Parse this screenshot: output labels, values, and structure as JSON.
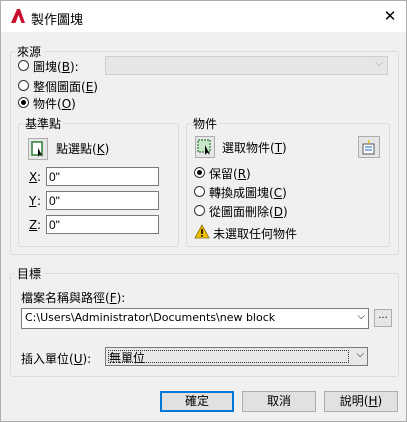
{
  "window": {
    "title": "製作圖塊",
    "app_icon": "autocad-a-icon",
    "close_glyph": "✕"
  },
  "source": {
    "legend": "來源",
    "options": [
      {
        "label": "圖塊",
        "key": "B",
        "selected": false
      },
      {
        "label": "整個圖面",
        "key": "E",
        "selected": false
      },
      {
        "label": "物件",
        "key": "O",
        "selected": true
      }
    ],
    "block_combo_value": "",
    "base_point": {
      "legend": "基準點",
      "pick_label": "點選點",
      "pick_key": "K",
      "x_label": "X",
      "y_label": "Y",
      "z_label": "Z",
      "x_value": "0\"",
      "y_value": "0\"",
      "z_value": "0\""
    },
    "objects": {
      "legend": "物件",
      "select_label": "選取物件",
      "select_key": "T",
      "options": [
        {
          "label": "保留",
          "key": "R",
          "selected": true
        },
        {
          "label": "轉換成圖塊",
          "key": "C",
          "selected": false
        },
        {
          "label": "從圖面刪除",
          "key": "D",
          "selected": false
        }
      ],
      "warning": "未選取任何物件"
    }
  },
  "target": {
    "legend": "目標",
    "path_label": "檔案名稱與路徑",
    "path_key": "F",
    "path_value": "C:\\Users\\Administrator\\Documents\\new block",
    "browse_label": "...",
    "units_label": "插入單位",
    "units_key": "U",
    "units_value": "無單位"
  },
  "buttons": {
    "ok": "確定",
    "cancel": "取消",
    "help": "說明",
    "help_key": "H"
  },
  "colors": {
    "accent": "#0078d7",
    "logo_red": "#c8102e",
    "warning_yellow": "#f2c200"
  }
}
